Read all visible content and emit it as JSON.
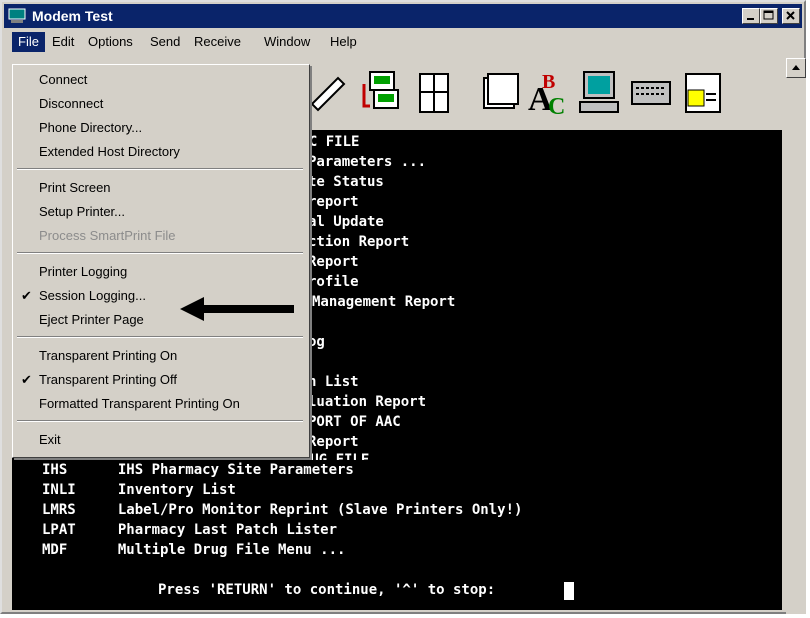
{
  "window": {
    "title": "Modem Test",
    "controls": [
      "minimize-button",
      "maximize-button",
      "close-button"
    ]
  },
  "menu_bar": {
    "items": [
      "File",
      "Edit",
      "Options",
      "Send",
      "Receive",
      "Window",
      "Help"
    ]
  },
  "file_menu": {
    "items": [
      {
        "label": "Connect",
        "enabled": true,
        "checked": false
      },
      {
        "label": "Disconnect",
        "enabled": true,
        "checked": false
      },
      {
        "label": "Phone Directory...",
        "enabled": true,
        "checked": false
      },
      {
        "label": "Extended Host Directory",
        "enabled": true,
        "checked": false
      },
      {
        "label": "Print Screen",
        "enabled": true,
        "checked": false
      },
      {
        "label": "Setup Printer...",
        "enabled": true,
        "checked": false
      },
      {
        "label": "Process SmartPrint File",
        "enabled": false,
        "checked": false
      },
      {
        "label": "Printer Logging",
        "enabled": true,
        "checked": false
      },
      {
        "label": "Session Logging...",
        "enabled": true,
        "checked": true
      },
      {
        "label": "Eject Printer Page",
        "enabled": true,
        "checked": false
      },
      {
        "label": "Transparent Printing On",
        "enabled": true,
        "checked": false
      },
      {
        "label": "Transparent Printing Off",
        "enabled": true,
        "checked": true
      },
      {
        "label": "Formatted Transparent Printing On",
        "enabled": true,
        "checked": false
      },
      {
        "label": "Exit",
        "enabled": true,
        "checked": false
      }
    ],
    "check_glyph": "✔"
  },
  "terminal": {
    "lines": [
      "AAC FILE",
      "Parameters ...",
      "te Status",
      "report",
      "al Update",
      "ction Report",
      "Report",
      "rofile",
      "Management Report",
      "og",
      "n List",
      "luation Report",
      "PORT OF AAC",
      "Report",
      "FIND PROBLEM NDC'S IN DRUG FILE",
      "IHS      IHS Pharmacy Site Parameters",
      "INLI     Inventory List",
      "LMRS     Label/Pro Monitor Reprint (Slave Printers Only!)",
      "LPAT     Pharmacy Last Patch Lister",
      "MDF      Multiple Drug File Menu ...",
      "Press 'RETURN' to continue, '^' to stop:"
    ]
  },
  "colors": {
    "titlebar": "#0a246a",
    "terminal_bg": "#000000",
    "terminal_fg": "#ffffff",
    "chrome": "#d4d0c8"
  }
}
